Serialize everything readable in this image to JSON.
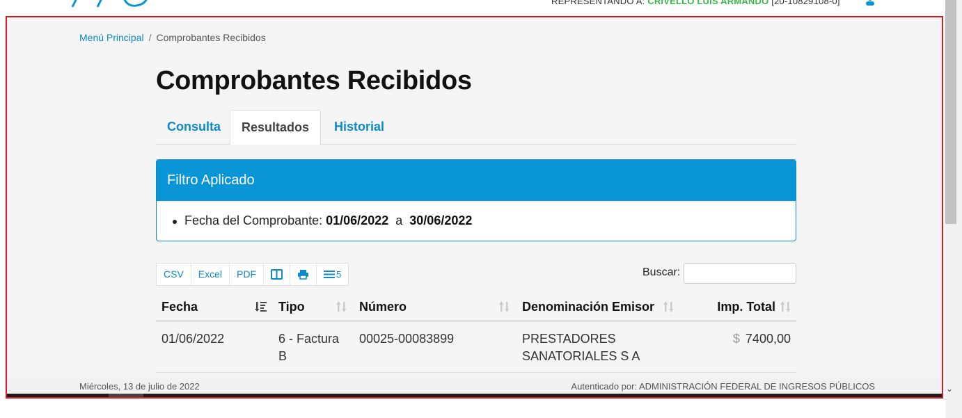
{
  "header": {
    "representing_label": "REPRESENTANDO A:",
    "representing_name": "CRIVELLO LUIS ARMANDO",
    "representing_cuit": "[20-10829108-0]",
    "user_icon": "user-icon"
  },
  "breadcrumb": {
    "home": "Menú Principal",
    "separator": "/",
    "current": "Comprobantes Recibidos"
  },
  "page": {
    "title": "Comprobantes Recibidos"
  },
  "tabs": [
    {
      "label": "Consulta",
      "active": false
    },
    {
      "label": "Resultados",
      "active": true
    },
    {
      "label": "Historial",
      "active": false
    }
  ],
  "filter": {
    "heading": "Filtro Aplicado",
    "label": "Fecha del Comprobante:",
    "from": "01/06/2022",
    "connector": "a",
    "to": "30/06/2022"
  },
  "toolbar": {
    "csv": "CSV",
    "excel": "Excel",
    "pdf": "PDF",
    "columns_icon": "columns-icon",
    "print_icon": "print-icon",
    "menu_icon": "list-icon",
    "page_length": "5"
  },
  "search": {
    "label": "Buscar:",
    "value": ""
  },
  "table": {
    "columns": [
      "Fecha",
      "Tipo",
      "Número",
      "Denominación Emisor",
      "Imp. Total"
    ],
    "rows": [
      {
        "fecha": "01/06/2022",
        "tipo": "6 - Factura B",
        "numero": "00025-00083899",
        "emisor": "PRESTADORES SANATORIALES S A",
        "currency": "$",
        "total": "7400,00"
      }
    ]
  },
  "footer": {
    "date": "Miércoles, 13 de julio de 2022",
    "auth": "Autenticado por: ADMINISTRACIÓN FEDERAL DE INGRESOS PÚBLICOS"
  },
  "colors": {
    "accent": "#0c89c8",
    "panel_head": "#0a96d6",
    "name_green": "#3cb54a",
    "frame_border": "#d9191c"
  }
}
